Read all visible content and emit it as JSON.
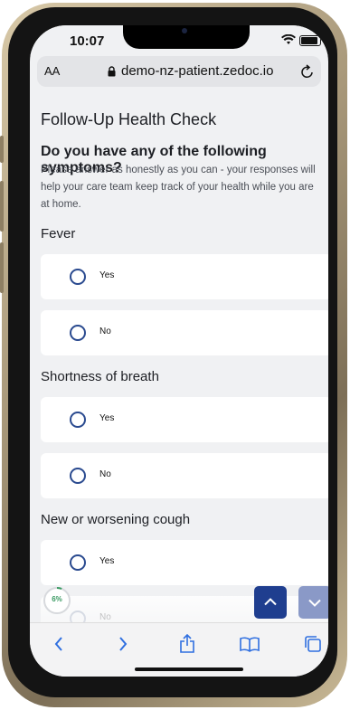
{
  "status_bar": {
    "time": "10:07"
  },
  "browser": {
    "text_size_label": "AA",
    "url": "demo-nz-patient.zedoc.io"
  },
  "page": {
    "title": "Follow-Up Health Check",
    "question": "Do you have any of the following symptoms?",
    "instructions": "Please answer as honestly as you can - your responses will help your care team keep track of your health while you are at home."
  },
  "sections": [
    {
      "label": "Fever",
      "options": [
        "Yes",
        "No"
      ]
    },
    {
      "label": "Shortness of breath",
      "options": [
        "Yes",
        "No"
      ]
    },
    {
      "label": "New or worsening cough",
      "options": [
        "Yes",
        "No"
      ]
    }
  ],
  "progress": {
    "label": "6%",
    "value": 0.06
  },
  "colors": {
    "accent": "#1f3e8f",
    "radio_border": "#2a4a8f",
    "progress": "#3a9a62"
  }
}
